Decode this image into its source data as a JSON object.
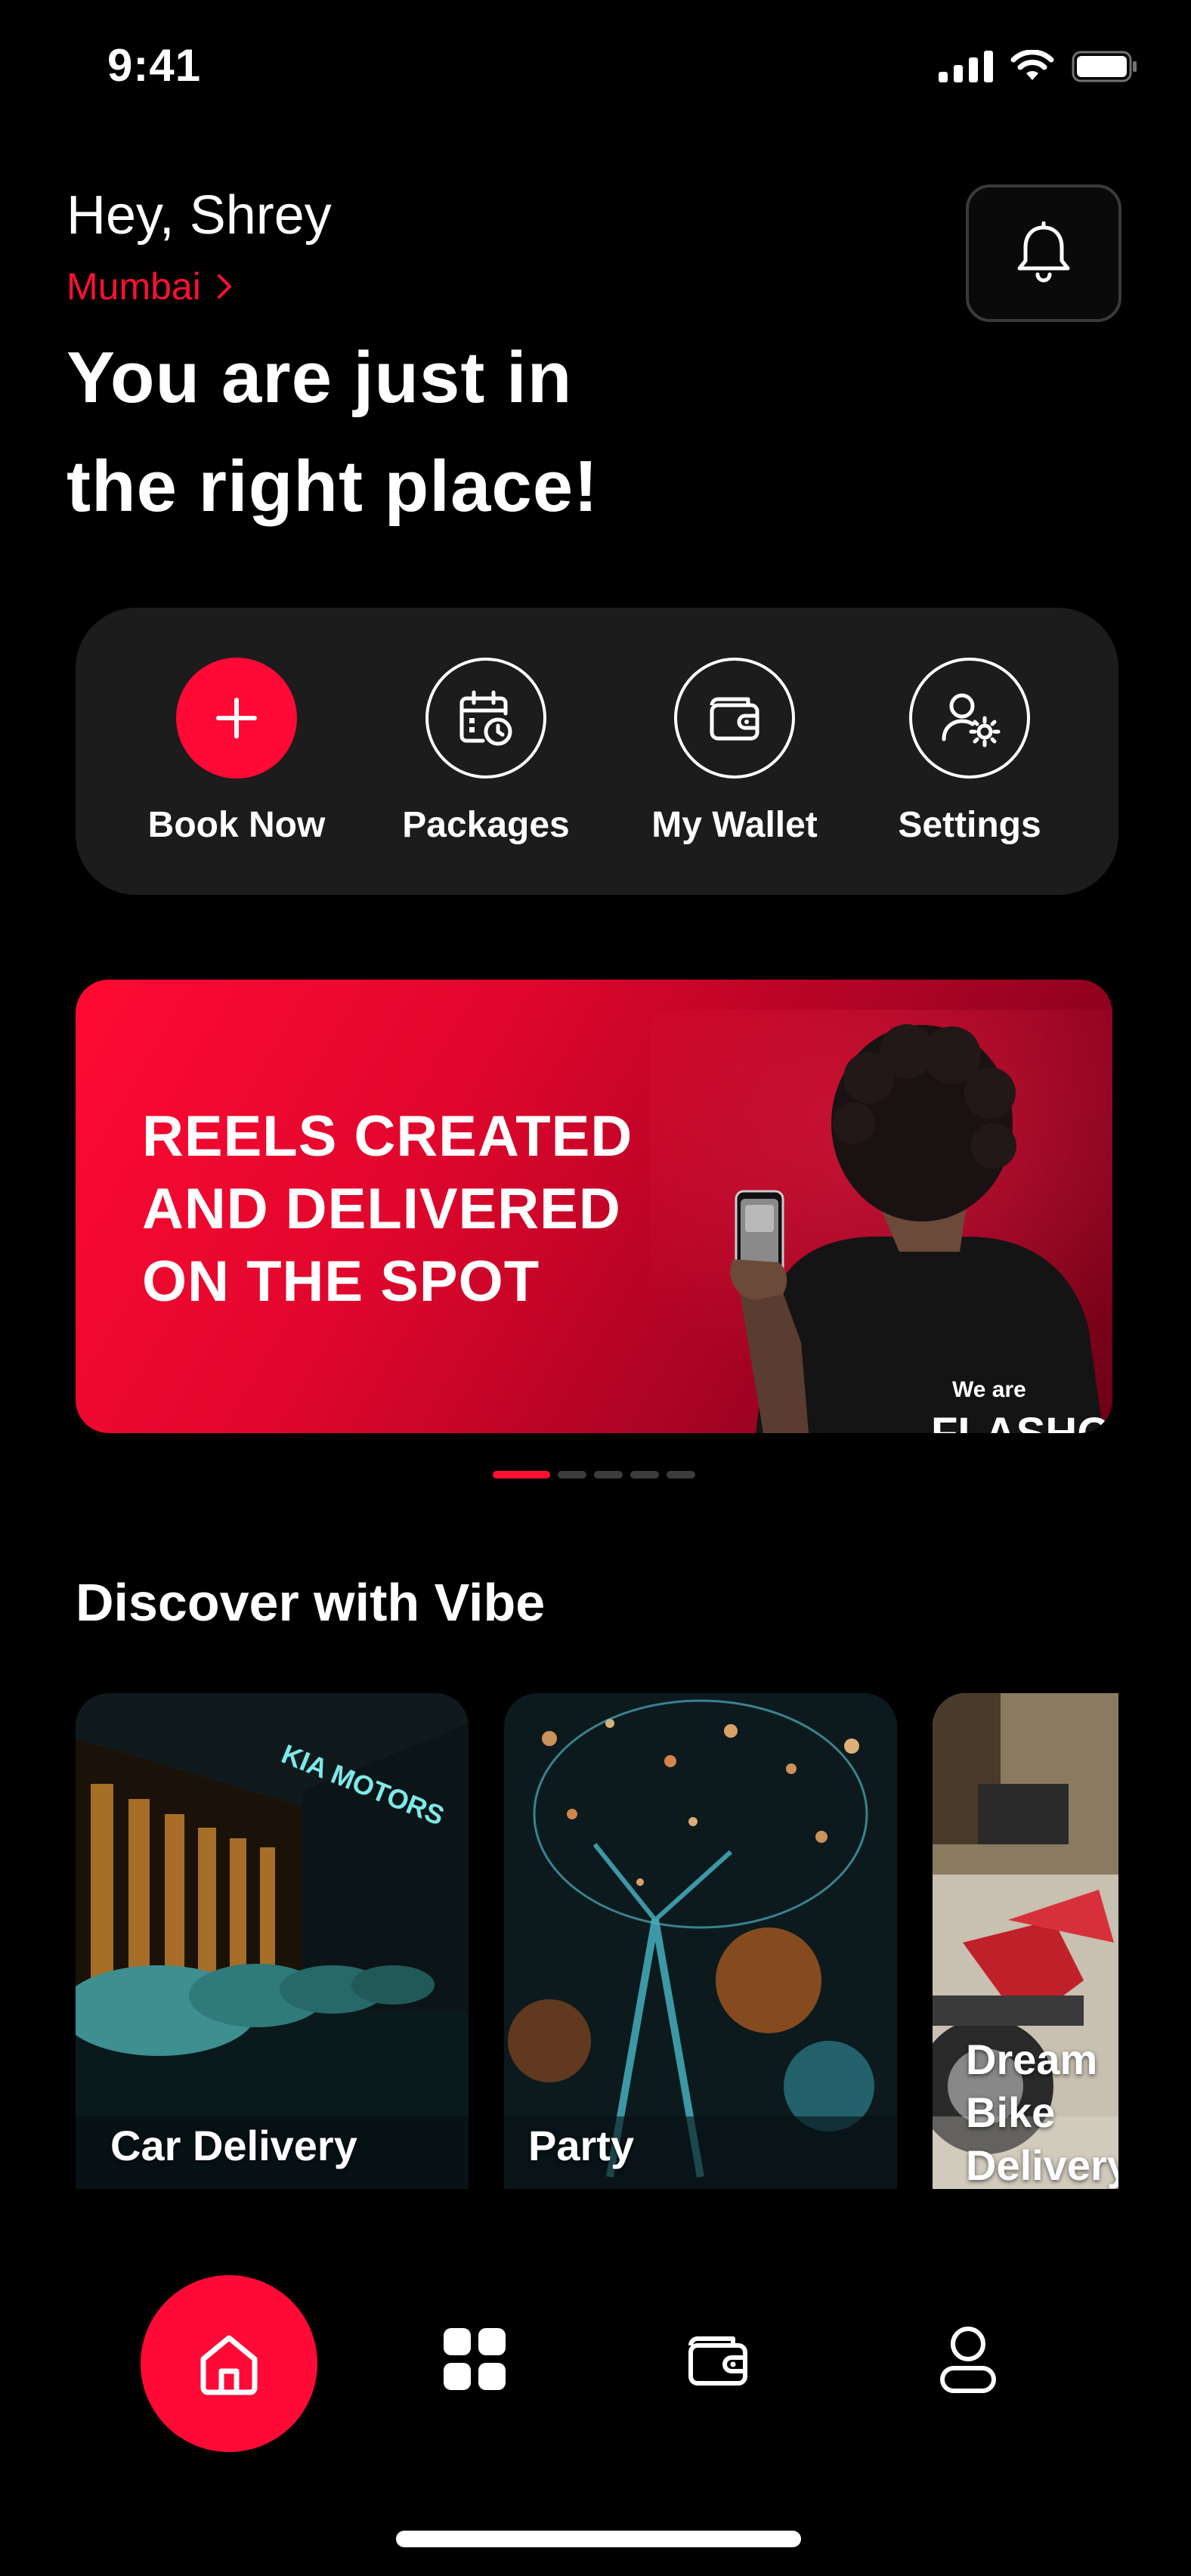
{
  "status_bar": {
    "time": "9:41"
  },
  "header": {
    "greeting": "Hey, Shrey",
    "city": "Mumbai",
    "headline_line1": "You are just in",
    "headline_line2": "the right place!"
  },
  "quick_actions": [
    {
      "label": "Book Now",
      "icon": "plus-icon"
    },
    {
      "label": "Packages",
      "icon": "calendar-clock-icon"
    },
    {
      "label": "My Wallet",
      "icon": "wallet-icon"
    },
    {
      "label": "Settings",
      "icon": "user-settings-icon"
    }
  ],
  "banner": {
    "line1": "REELS CREATED",
    "line2": "AND DELIVERED",
    "line3": "ON THE SPOT",
    "shirt_text": "We are",
    "shirt_brand": "FLASHOOT"
  },
  "carousel": {
    "total": 5,
    "active_index": 0
  },
  "discover": {
    "title": "Discover with Vibe",
    "cards": [
      {
        "label": "Car Delivery",
        "sign": "KIA MOTORS"
      },
      {
        "label": "Party"
      },
      {
        "label": "Dream Bike Delivery"
      }
    ]
  },
  "bottom_nav": [
    {
      "icon": "home-icon",
      "active": true
    },
    {
      "icon": "grid-icon",
      "active": false
    },
    {
      "icon": "wallet-icon",
      "active": false
    },
    {
      "icon": "profile-icon",
      "active": false
    }
  ],
  "colors": {
    "accent": "#FF0A36",
    "background": "#000000",
    "panel": "#1C1C1C"
  }
}
